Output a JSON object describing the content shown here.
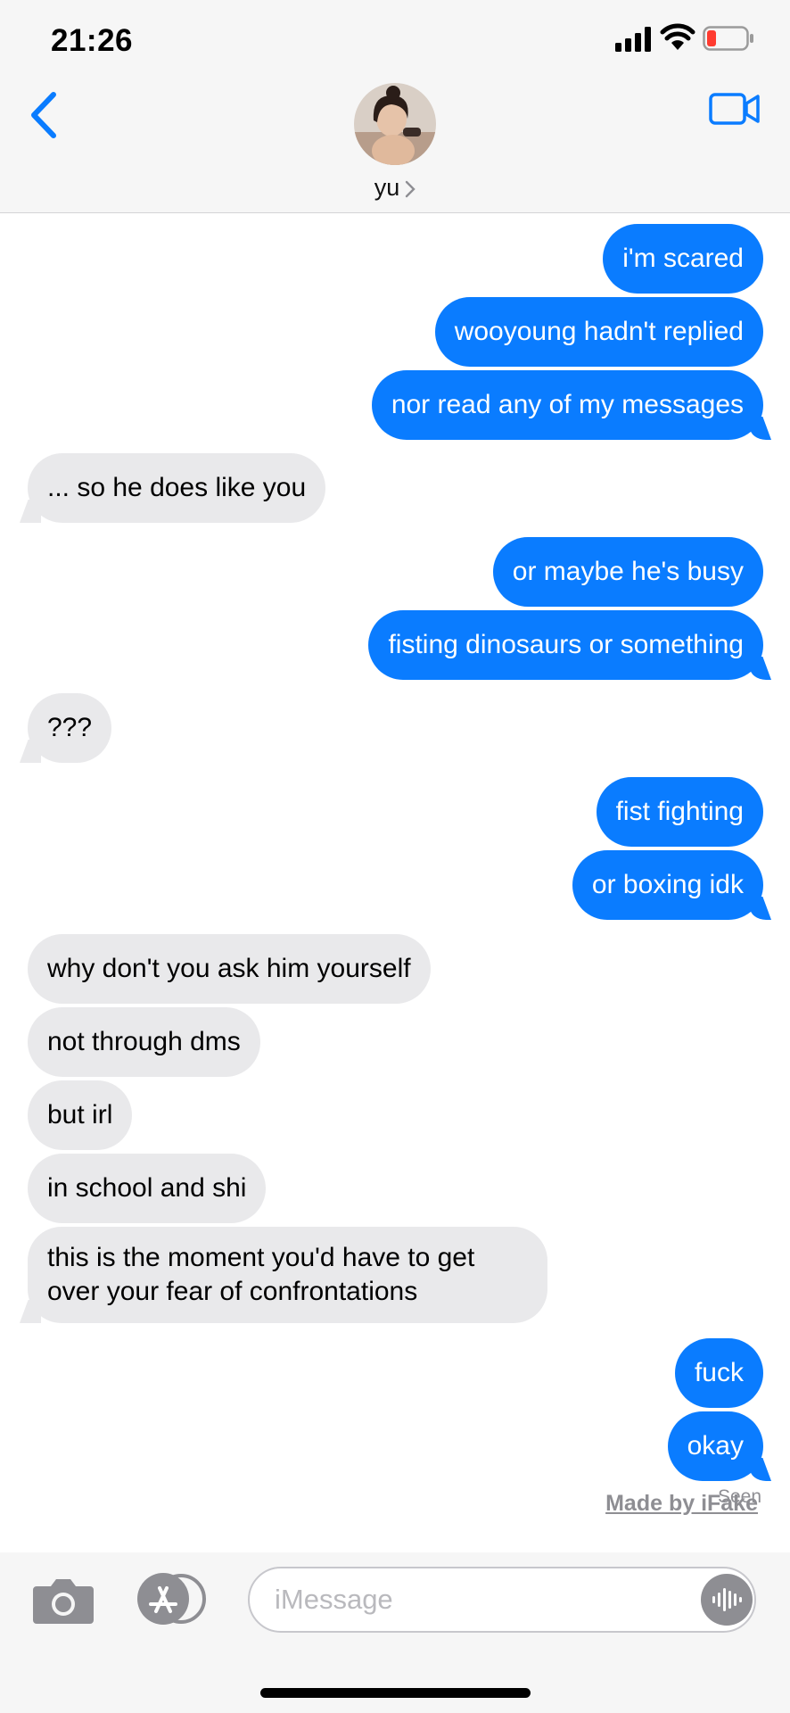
{
  "status": {
    "time": "21:26"
  },
  "header": {
    "contact_name": "yu"
  },
  "messages": [
    {
      "text": "i'm scared",
      "from": "me"
    },
    {
      "text": "wooyoung hadn't replied",
      "from": "me"
    },
    {
      "text": "nor read any of my messages",
      "from": "me"
    },
    {
      "text": "... so he does like you",
      "from": "them"
    },
    {
      "text": "or maybe he's busy",
      "from": "me"
    },
    {
      "text": "fisting dinosaurs or something",
      "from": "me"
    },
    {
      "text": "???",
      "from": "them"
    },
    {
      "text": "fist fighting",
      "from": "me"
    },
    {
      "text": "or boxing idk",
      "from": "me"
    },
    {
      "text": "why don't you ask him yourself",
      "from": "them"
    },
    {
      "text": "not through dms",
      "from": "them"
    },
    {
      "text": "but irl",
      "from": "them"
    },
    {
      "text": "in school and shi",
      "from": "them"
    },
    {
      "text": "this is the moment you'd have to get over your fear of confrontations",
      "from": "them"
    },
    {
      "text": "fuck",
      "from": "me"
    },
    {
      "text": "okay",
      "from": "me"
    }
  ],
  "receipt": "Seen",
  "watermark": "Made by iFake",
  "composer": {
    "placeholder": "iMessage"
  },
  "colors": {
    "outgoing": "#0a7cff",
    "incoming": "#e9e9eb",
    "accent": "#0a7cff"
  }
}
